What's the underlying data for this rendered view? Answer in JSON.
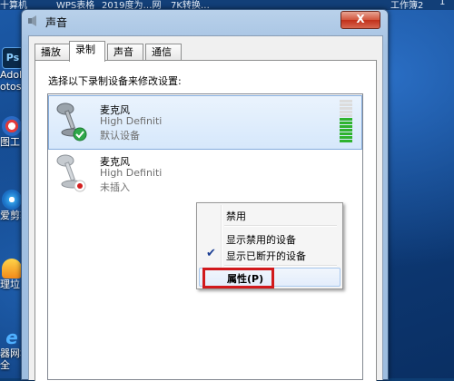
{
  "desktop": {
    "top_strip": [
      "十算机",
      "WPS表格",
      "2019度为…网",
      "7K转换…",
      "工作簿2",
      "1"
    ],
    "icons": [
      {
        "label": "Adob",
        "icon": "photoshop-icon"
      },
      {
        "label": "otos",
        "icon": "photoshop-icon"
      },
      {
        "label": "图工",
        "icon": "image-tool-icon"
      },
      {
        "label": "爱剪辑",
        "icon": "video-editor-icon"
      },
      {
        "label": "理垃",
        "icon": "cleanup-icon"
      },
      {
        "label": "器网址",
        "icon": "ie-browser-icon"
      },
      {
        "label": "全",
        "icon": "ie-browser-icon"
      }
    ]
  },
  "window": {
    "title": "声音",
    "close_label": "X",
    "tabs": [
      {
        "label": "播放",
        "active": false
      },
      {
        "label": "录制",
        "active": true
      },
      {
        "label": "声音",
        "active": false
      },
      {
        "label": "通信",
        "active": false
      }
    ],
    "instruction": "选择以下录制设备来修改设置:",
    "devices": [
      {
        "name": "麦克风",
        "description": "High Definiti",
        "status": "默认设备",
        "status_icon": "check-icon"
      },
      {
        "name": "麦克风",
        "description": "High Definiti",
        "status": "未插入",
        "status_icon": "unplugged-icon"
      }
    ]
  },
  "context_menu": {
    "items": [
      {
        "label": "禁用",
        "checked": false
      },
      {
        "label": "显示禁用的设备",
        "checked": false
      },
      {
        "label": "显示已断开的设备",
        "checked": true
      },
      {
        "label": "属性(P)",
        "checked": false,
        "highlighted": true
      }
    ]
  },
  "level_meter": 0.55,
  "colors": {
    "highlight_box": "#d1191c",
    "selection": "#d6e8fb",
    "meter": "#2fb32f"
  }
}
